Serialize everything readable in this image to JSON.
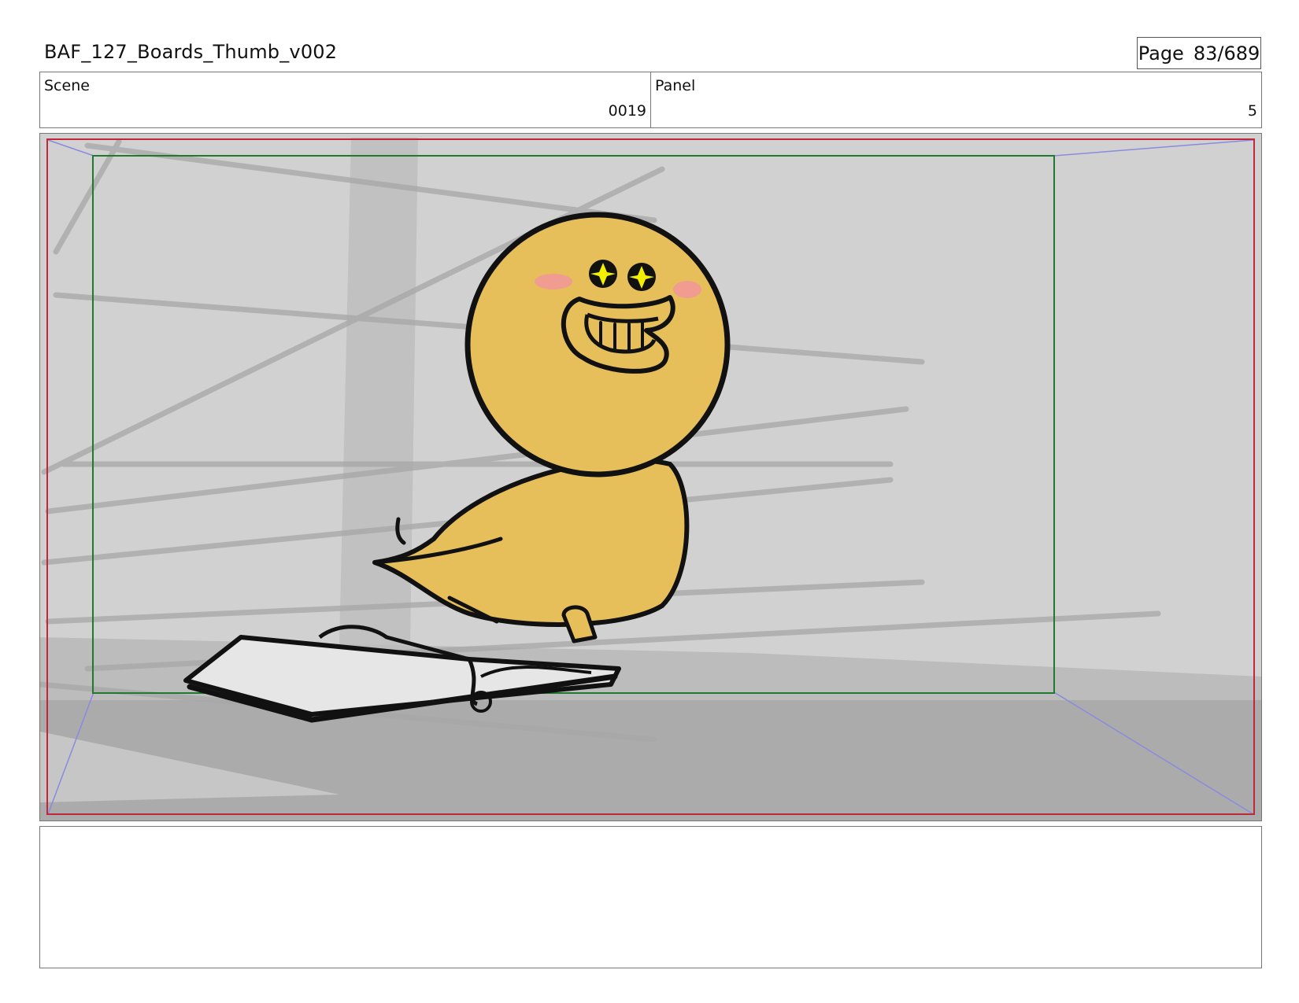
{
  "header": {
    "title": "BAF_127_Boards_Thumb_v002",
    "page_label": "Page",
    "page_value": "83/689"
  },
  "info": {
    "scene_label": "Scene",
    "scene_value": "0019",
    "panel_label": "Panel",
    "panel_value": "5"
  },
  "colors": {
    "safe_frame": "#c0283a",
    "action_safe": "#1f7a2e",
    "camera_guides": "#8a8ae0",
    "character_fill": "#e7bf5a",
    "blush": "#f19c90",
    "eye_sparkle": "#f2f000",
    "background_gray": "#d1d1d1"
  },
  "notes": {
    "text": ""
  }
}
